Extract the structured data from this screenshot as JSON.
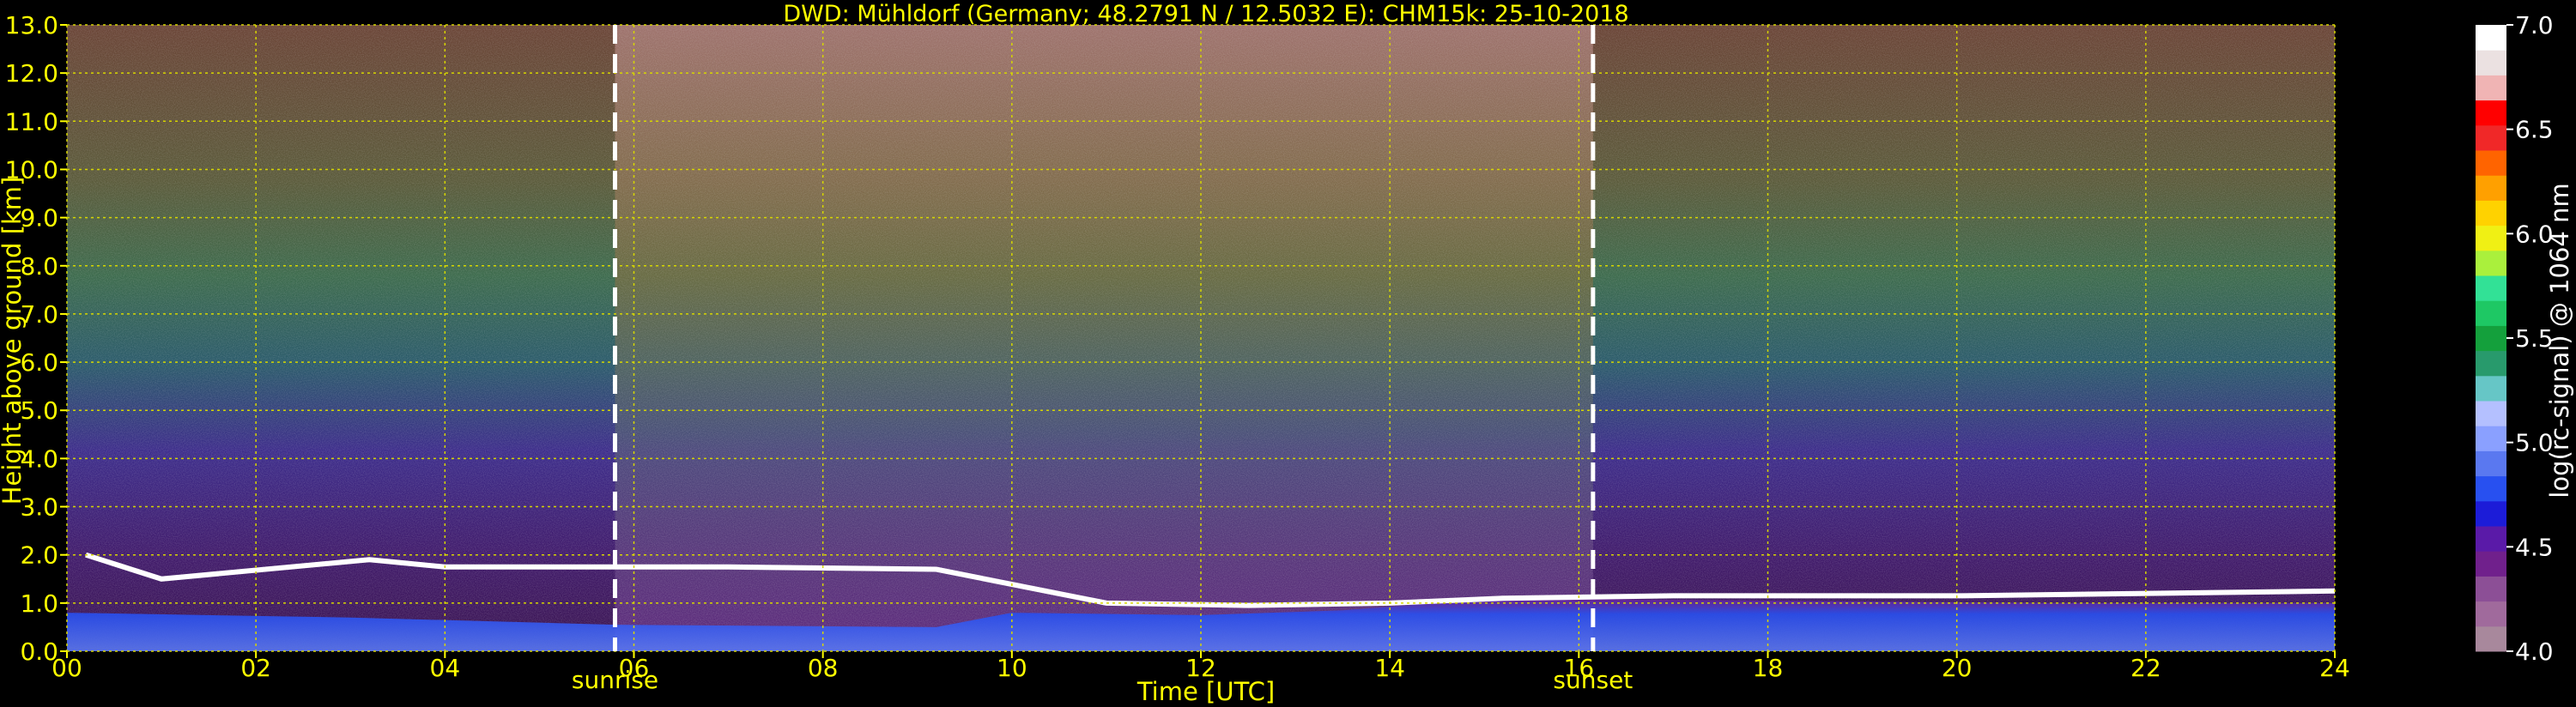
{
  "chart_data": {
    "type": "heatmap",
    "title": "DWD: Mühldorf (Germany; 48.2791 N / 12.5032 E):    CHM15k: 25-10-2018",
    "xlabel": "Time [UTC]",
    "ylabel": "Height above ground [km]",
    "xlim": [
      0,
      24
    ],
    "ylim": [
      0,
      13
    ],
    "x_ticks": [
      "00",
      "02",
      "04",
      "06",
      "08",
      "10",
      "12",
      "14",
      "16",
      "18",
      "20",
      "22",
      "24"
    ],
    "y_ticks": [
      "0.0",
      "1.0",
      "2.0",
      "3.0",
      "4.0",
      "5.0",
      "6.0",
      "7.0",
      "8.0",
      "9.0",
      "10.0",
      "11.0",
      "12.0",
      "13.0"
    ],
    "grid": true,
    "events": [
      {
        "label": "sunrise",
        "time": 5.8
      },
      {
        "label": "sunset",
        "time": 16.15
      }
    ],
    "colorbar": {
      "label": "log(rc-signal) @ 1064 nm",
      "range": [
        4.0,
        7.0
      ],
      "ticks": [
        "4.0",
        "4.5",
        "5.0",
        "5.5",
        "6.0",
        "6.5",
        "7.0"
      ],
      "colors": [
        "#a8889c",
        "#a06a9c",
        "#8c4f96",
        "#70208c",
        "#5a1aa8",
        "#1c1cd8",
        "#2850f0",
        "#5a78f0",
        "#8aa0ff",
        "#b4c0ff",
        "#66c6c6",
        "#289a6c",
        "#14a03c",
        "#1ec864",
        "#32e196",
        "#aaf03c",
        "#f0f014",
        "#ffd200",
        "#ffa000",
        "#ff6400",
        "#f02828",
        "#ff0000",
        "#f0b4b4",
        "#ebe1e1",
        "#ffffff"
      ]
    },
    "boundary_layer_top_km": [
      {
        "time": 0.2,
        "height": 2.0
      },
      {
        "time": 1.0,
        "height": 1.5
      },
      {
        "time": 3.2,
        "height": 1.9
      },
      {
        "time": 4.0,
        "height": 1.75
      },
      {
        "time": 5.8,
        "height": 1.75
      },
      {
        "time": 7.0,
        "height": 1.75
      },
      {
        "time": 9.2,
        "height": 1.7
      },
      {
        "time": 11.0,
        "height": 1.0
      },
      {
        "time": 12.5,
        "height": 0.95
      },
      {
        "time": 14.0,
        "height": 1.0
      },
      {
        "time": 15.2,
        "height": 1.1
      },
      {
        "time": 17.0,
        "height": 1.15
      },
      {
        "time": 20.0,
        "height": 1.15
      },
      {
        "time": 24.0,
        "height": 1.25
      }
    ],
    "aerosol_layer_top_km": [
      {
        "time": 0.0,
        "height": 0.8
      },
      {
        "time": 3.0,
        "height": 0.7
      },
      {
        "time": 5.8,
        "height": 0.55
      },
      {
        "time": 9.2,
        "height": 0.5
      },
      {
        "time": 10.0,
        "height": 0.8
      },
      {
        "time": 12.0,
        "height": 0.75
      },
      {
        "time": 13.5,
        "height": 0.85
      },
      {
        "time": 15.2,
        "height": 1.1
      },
      {
        "time": 18.0,
        "height": 1.05
      },
      {
        "time": 21.0,
        "height": 1.0
      },
      {
        "time": 24.0,
        "height": 1.0
      }
    ]
  }
}
